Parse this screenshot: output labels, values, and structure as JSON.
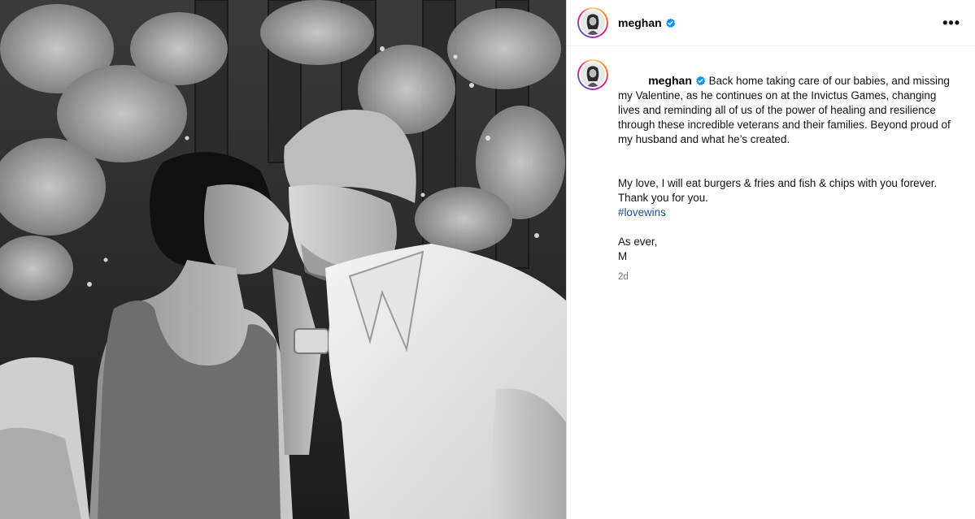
{
  "post": {
    "username": "meghan",
    "verified": true,
    "more_icon": "more-options-icon",
    "more_label": "•••"
  },
  "caption": {
    "username": "meghan",
    "lines": [
      "Back home taking care of our babies, and missing my Valentine, as he continues on at the Invictus Games, changing lives and reminding all of us of the power of healing and resilience through these incredible veterans and their families. Beyond proud of my husband and what he’s created.",
      "My love, I will eat burgers & fries and fish & chips with you forever. Thank you for you."
    ],
    "hashtag": "#lovewins",
    "signoff_1": "As ever,",
    "signoff_2": "M",
    "timestamp": "2d"
  },
  "colors": {
    "verified": "#0095f6",
    "hashtag": "#1e4f8f",
    "muted": "#737373"
  }
}
